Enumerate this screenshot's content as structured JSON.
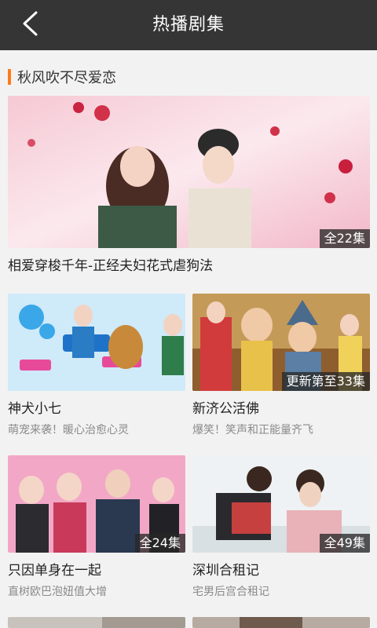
{
  "header": {
    "title": "热播剧集",
    "back_icon": "chevron-left-icon"
  },
  "section": {
    "title": "秋风吹不尽爱恋",
    "accent_color": "#ff7a1a"
  },
  "featured": {
    "badge": "全22集",
    "title": "相爱穿梭千年-正经夫妇花式虐狗法"
  },
  "grid": [
    {
      "title": "神犬小七",
      "subtitle": "萌宠来袭！暖心治愈心灵",
      "badge": ""
    },
    {
      "title": "新济公活佛",
      "subtitle": "爆笑！笑声和正能量齐飞",
      "badge": "更新第至33集"
    },
    {
      "title": "只因单身在一起",
      "subtitle": "直树欧巴泡妞值大增",
      "badge": "全24集"
    },
    {
      "title": "深圳合租记",
      "subtitle": "宅男后宫合租记",
      "badge": "全49集"
    }
  ]
}
